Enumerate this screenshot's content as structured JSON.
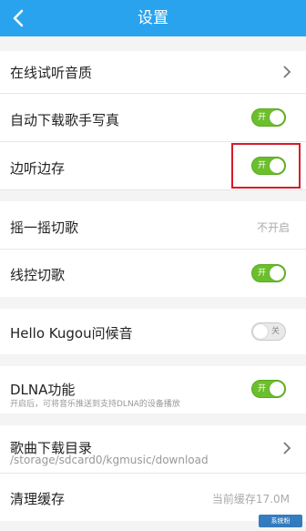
{
  "header": {
    "title": "设置"
  },
  "settings": {
    "audition_quality": {
      "label": "在线试听音质"
    },
    "auto_download_photo": {
      "label": "自动下载歌手写真",
      "toggle": "开",
      "on": true
    },
    "play_cache": {
      "label": "边听边存",
      "toggle": "开",
      "on": true
    },
    "shake_switch": {
      "label": "摇一摇切歌",
      "value": "不开启"
    },
    "wire_control": {
      "label": "线控切歌",
      "toggle": "开",
      "on": true
    },
    "hello_kugou": {
      "label": "Hello Kugou问候音",
      "toggle": "关",
      "on": false
    },
    "dlna": {
      "label": "DLNA功能",
      "description": "开启后，可将音乐推送到支持DLNA的设备播放",
      "toggle": "开",
      "on": true
    },
    "download_dir": {
      "label": "歌曲下载目录",
      "path": "/storage/sdcard0/kgmusic/download"
    },
    "clear_cache": {
      "label": "清理缓存",
      "value": "当前缓存17.0M"
    }
  },
  "watermark": {
    "text": "系统粉"
  },
  "colors": {
    "header": "#2aa3ee",
    "toggle_on": "#6cbf2c",
    "highlight": "#d7192a"
  }
}
